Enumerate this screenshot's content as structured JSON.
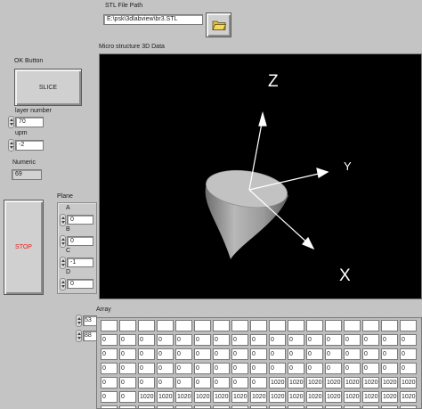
{
  "stl": {
    "label": "STL File Path",
    "value": "E:\\psk\\3dlabview\\br3.STL"
  },
  "scene": {
    "label": "Micro structure 3D Data",
    "axes": {
      "z": "Z",
      "y": "Y",
      "x": "X"
    }
  },
  "ok_button": {
    "label": "OK Button",
    "text": "SLICE"
  },
  "layer_number": {
    "label": "layer number",
    "value": "70"
  },
  "upm": {
    "label": "upm",
    "value": "-2"
  },
  "numeric": {
    "label": "Numeric",
    "value": "69"
  },
  "stop_button": {
    "text": "STOP",
    "color": "#e02020"
  },
  "plane": {
    "label": "Plane",
    "fields": [
      {
        "name": "A",
        "value": "0"
      },
      {
        "name": "B",
        "value": "0"
      },
      {
        "name": "C",
        "value": "-1"
      },
      {
        "name": "D",
        "value": "0"
      }
    ]
  },
  "array": {
    "label": "Array",
    "index_0": "53",
    "index_1": "88",
    "rows": [
      [
        "",
        "",
        "",
        "",
        "",
        "",
        "",
        "",
        "",
        "",
        "",
        "",
        "",
        "",
        "",
        "",
        ""
      ],
      [
        "0",
        "0",
        "0",
        "0",
        "0",
        "0",
        "0",
        "0",
        "0",
        "0",
        "0",
        "0",
        "0",
        "0",
        "0",
        "0",
        "0"
      ],
      [
        "0",
        "0",
        "0",
        "0",
        "0",
        "0",
        "0",
        "0",
        "0",
        "0",
        "0",
        "0",
        "0",
        "0",
        "0",
        "0",
        "0"
      ],
      [
        "0",
        "0",
        "0",
        "0",
        "0",
        "0",
        "0",
        "0",
        "0",
        "0",
        "0",
        "0",
        "0",
        "0",
        "0",
        "0",
        "0"
      ],
      [
        "0",
        "0",
        "0",
        "0",
        "0",
        "0",
        "0",
        "0",
        "0",
        "1020",
        "1020",
        "1020",
        "1020",
        "1020",
        "1020",
        "1020",
        "1020"
      ],
      [
        "0",
        "0",
        "1020",
        "1020",
        "1020",
        "1020",
        "1020",
        "1020",
        "1020",
        "1020",
        "1020",
        "1020",
        "1020",
        "1020",
        "1020",
        "1020",
        "1020"
      ],
      [
        "",
        "",
        "",
        "",
        "",
        "",
        "",
        "",
        "",
        "",
        "",
        "",
        "",
        "",
        "",
        "",
        ""
      ]
    ]
  }
}
